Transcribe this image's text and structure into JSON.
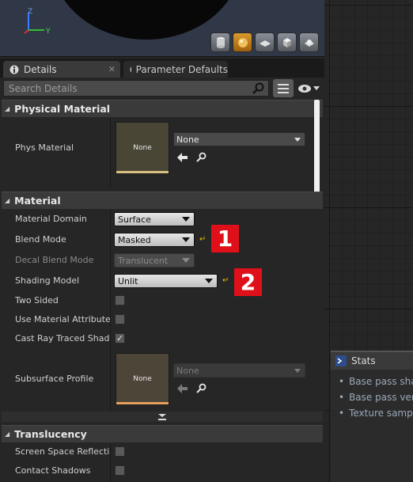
{
  "viewport": {
    "axis_z": "Z",
    "axis_y": "Y",
    "buttons": [
      "cylinder-icon",
      "sphere-icon",
      "plane-icon",
      "cube-icon",
      "custom-mesh-icon"
    ]
  },
  "tabs": [
    {
      "label": "Details",
      "close": "✕"
    },
    {
      "label": "Parameter Defaults",
      "close": ""
    }
  ],
  "search": {
    "placeholder": "Search Details"
  },
  "physical_material": {
    "header": "Physical Material",
    "phys_material_label": "Phys Material",
    "thumb_text": "None",
    "combo_value": "None"
  },
  "material": {
    "header": "Material",
    "rows": {
      "domain": {
        "label": "Material Domain",
        "value": "Surface"
      },
      "blend": {
        "label": "Blend Mode",
        "value": "Masked"
      },
      "decal": {
        "label": "Decal Blend Mode",
        "value": "Translucent"
      },
      "shading": {
        "label": "Shading Model",
        "value": "Unlit"
      },
      "two_sided": {
        "label": "Two Sided"
      },
      "use_attrs": {
        "label": "Use Material Attributes"
      },
      "cast_ray": {
        "label": "Cast Ray Traced Shadows"
      },
      "subsurface": {
        "label": "Subsurface Profile",
        "thumb_text": "None",
        "combo_value": "None"
      }
    },
    "badges": [
      "1",
      "2"
    ]
  },
  "translucency": {
    "header": "Translucency",
    "rows": [
      "Screen Space Reflections",
      "Contact Shadows"
    ]
  },
  "stats": {
    "title": "Stats",
    "lines": [
      "Base pass shader",
      "Base pass vertex",
      "Texture samplers"
    ]
  },
  "colors": {
    "accent_orange": "#d89a2c",
    "badge_red": "#e0101a",
    "reset_yellow": "#e8c000"
  }
}
